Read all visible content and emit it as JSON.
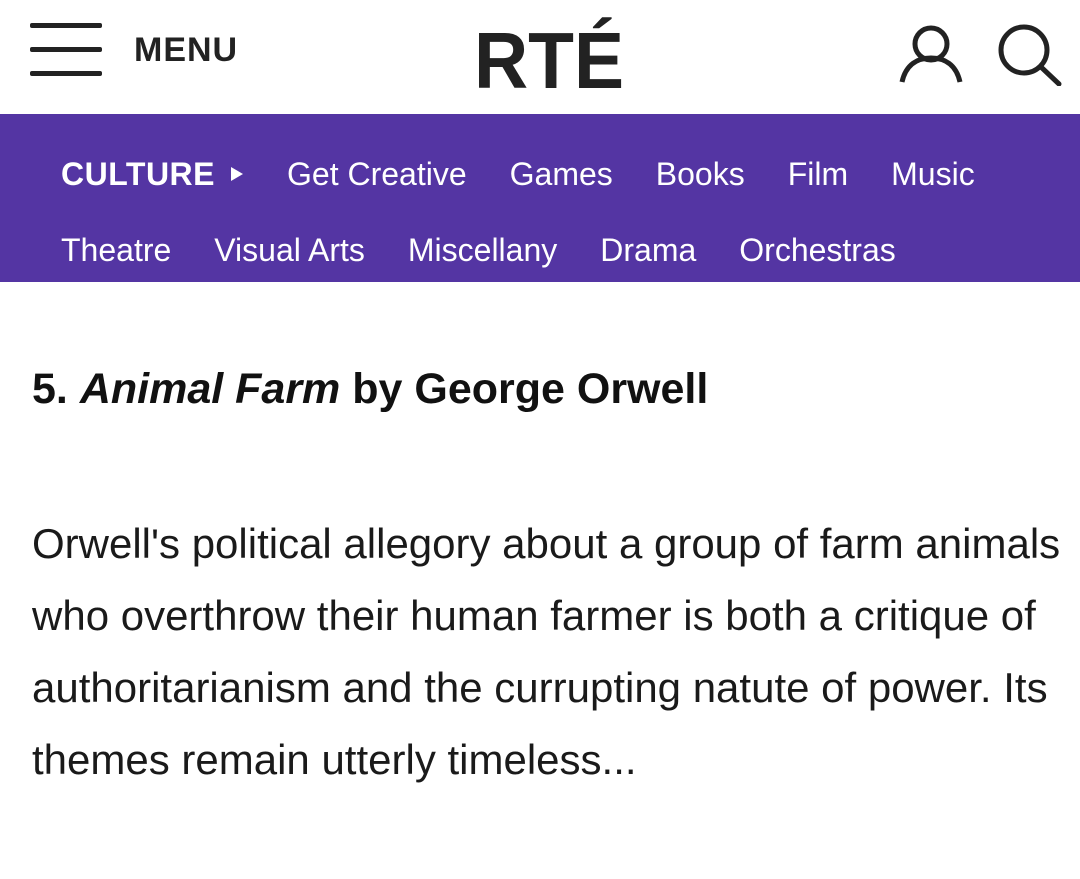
{
  "header": {
    "menu_label": "MENU",
    "logo_text": "RTÉ"
  },
  "nav": {
    "section": "CULTURE",
    "row1": [
      "Get Creative",
      "Games",
      "Books",
      "Film",
      "Music"
    ],
    "row2": [
      "Theatre",
      "Visual Arts",
      "Miscellany",
      "Drama",
      "Orchestras"
    ],
    "background": "#5435a3"
  },
  "article": {
    "number": "5.",
    "book_title": "Animal Farm",
    "byline": "by George Orwell",
    "body": "Orwell's political allegory about a group of farm animals who overthrow their human farmer is both a critique of authoritarianism and the currupting natute of power. Its themes remain utterly timeless..."
  }
}
